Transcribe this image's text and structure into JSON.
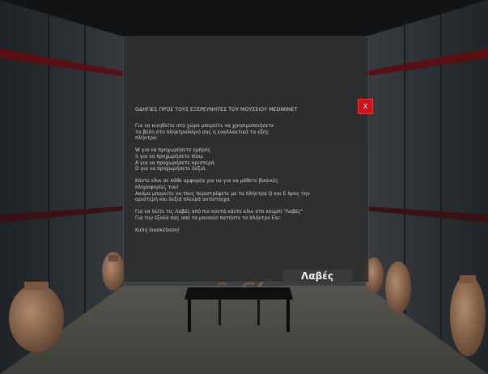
{
  "dialog": {
    "title": "ΟΔΗΓΙΕΣ ΠΡΟΣ ΤΟΥΣ ΕΞΕΡΕΥΝΗΤΕΣ ΤΟΥ ΜΟΥΣΕΙΟΥ MEDWINET",
    "close_label": "X",
    "ok_label": "Λαβές",
    "lines": [
      "Για να κινηθείτε στο χώρο μπορείτε να χρησιμοποιήσετε",
      "τα βέλη στο πληκτρολόγιό σας ή εναλλακτικά τα εξής",
      "πλήκτρα:",
      "",
      "W για να προχωρήσετε εμπρός",
      "S για να προχωρήσετε πίσω",
      "A για να προχωρήσετε αριστερά",
      "D για να προχωρήσετε δεξιά.",
      "",
      "Κάντε κλικ σε κάθε αμφορέα για να για να μάθετε βασικές",
      "πληροφορίες του!",
      "Ακόμα μπορείτε να τους περιστρέψετε με τα πλήκτρα Q και E προς την",
      "αριστερή και δεξιά πλευρά αντίστοιχα.",
      "",
      "Για να δείτε τις Λαβές από πιο κοντά κάντε κλικ στο κουμπί \"Λαβές\"",
      "Για την έξοδό σας από το μουσείο πατήστε το πλήκτρο Esc.",
      "",
      "Καλή διασκέδαση!"
    ]
  },
  "colors": {
    "close_bg": "#c9141a",
    "panel_bg": "#2e2e2e",
    "wall": "#2a3035",
    "floor": "#4a4a46"
  }
}
